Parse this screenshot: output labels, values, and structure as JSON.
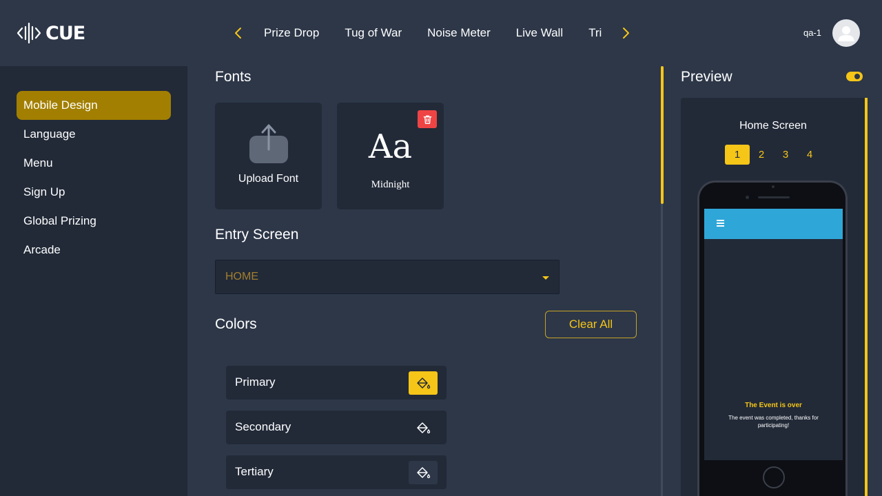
{
  "header": {
    "logo_text": "CUE",
    "nav_items": [
      "Prize Drop",
      "Tug of War",
      "Noise Meter",
      "Live Wall",
      "Tri"
    ],
    "user_name": "qa-1"
  },
  "sidebar": {
    "items": [
      {
        "label": "Mobile Design",
        "active": true
      },
      {
        "label": "Language",
        "active": false
      },
      {
        "label": "Menu",
        "active": false
      },
      {
        "label": "Sign Up",
        "active": false
      },
      {
        "label": "Global Prizing",
        "active": false
      },
      {
        "label": "Arcade",
        "active": false
      }
    ]
  },
  "fonts": {
    "title": "Fonts",
    "upload_label": "Upload Font",
    "sample_text": "Aa",
    "font_name": "Midnight"
  },
  "entry_screen": {
    "title": "Entry Screen",
    "selected": "HOME"
  },
  "colors": {
    "title": "Colors",
    "clear_label": "Clear All",
    "rows": [
      {
        "label": "Primary",
        "swatch": "#f5c518"
      },
      {
        "label": "Secondary",
        "swatch": "#222a38"
      },
      {
        "label": "Tertiary",
        "swatch": "#2d3748"
      }
    ]
  },
  "preview": {
    "title": "Preview",
    "toggle_on": true,
    "screen_title": "Home Screen",
    "pages": [
      "1",
      "2",
      "3",
      "4"
    ],
    "active_page": "1",
    "phone": {
      "app_bar_color": "#2fa6d8",
      "event_title": "The Event is over",
      "event_message": "The event was completed, thanks for participating!"
    }
  },
  "theme": {
    "accent": "#f5c518",
    "active_nav": "#a27f00",
    "danger": "#ef4444"
  }
}
